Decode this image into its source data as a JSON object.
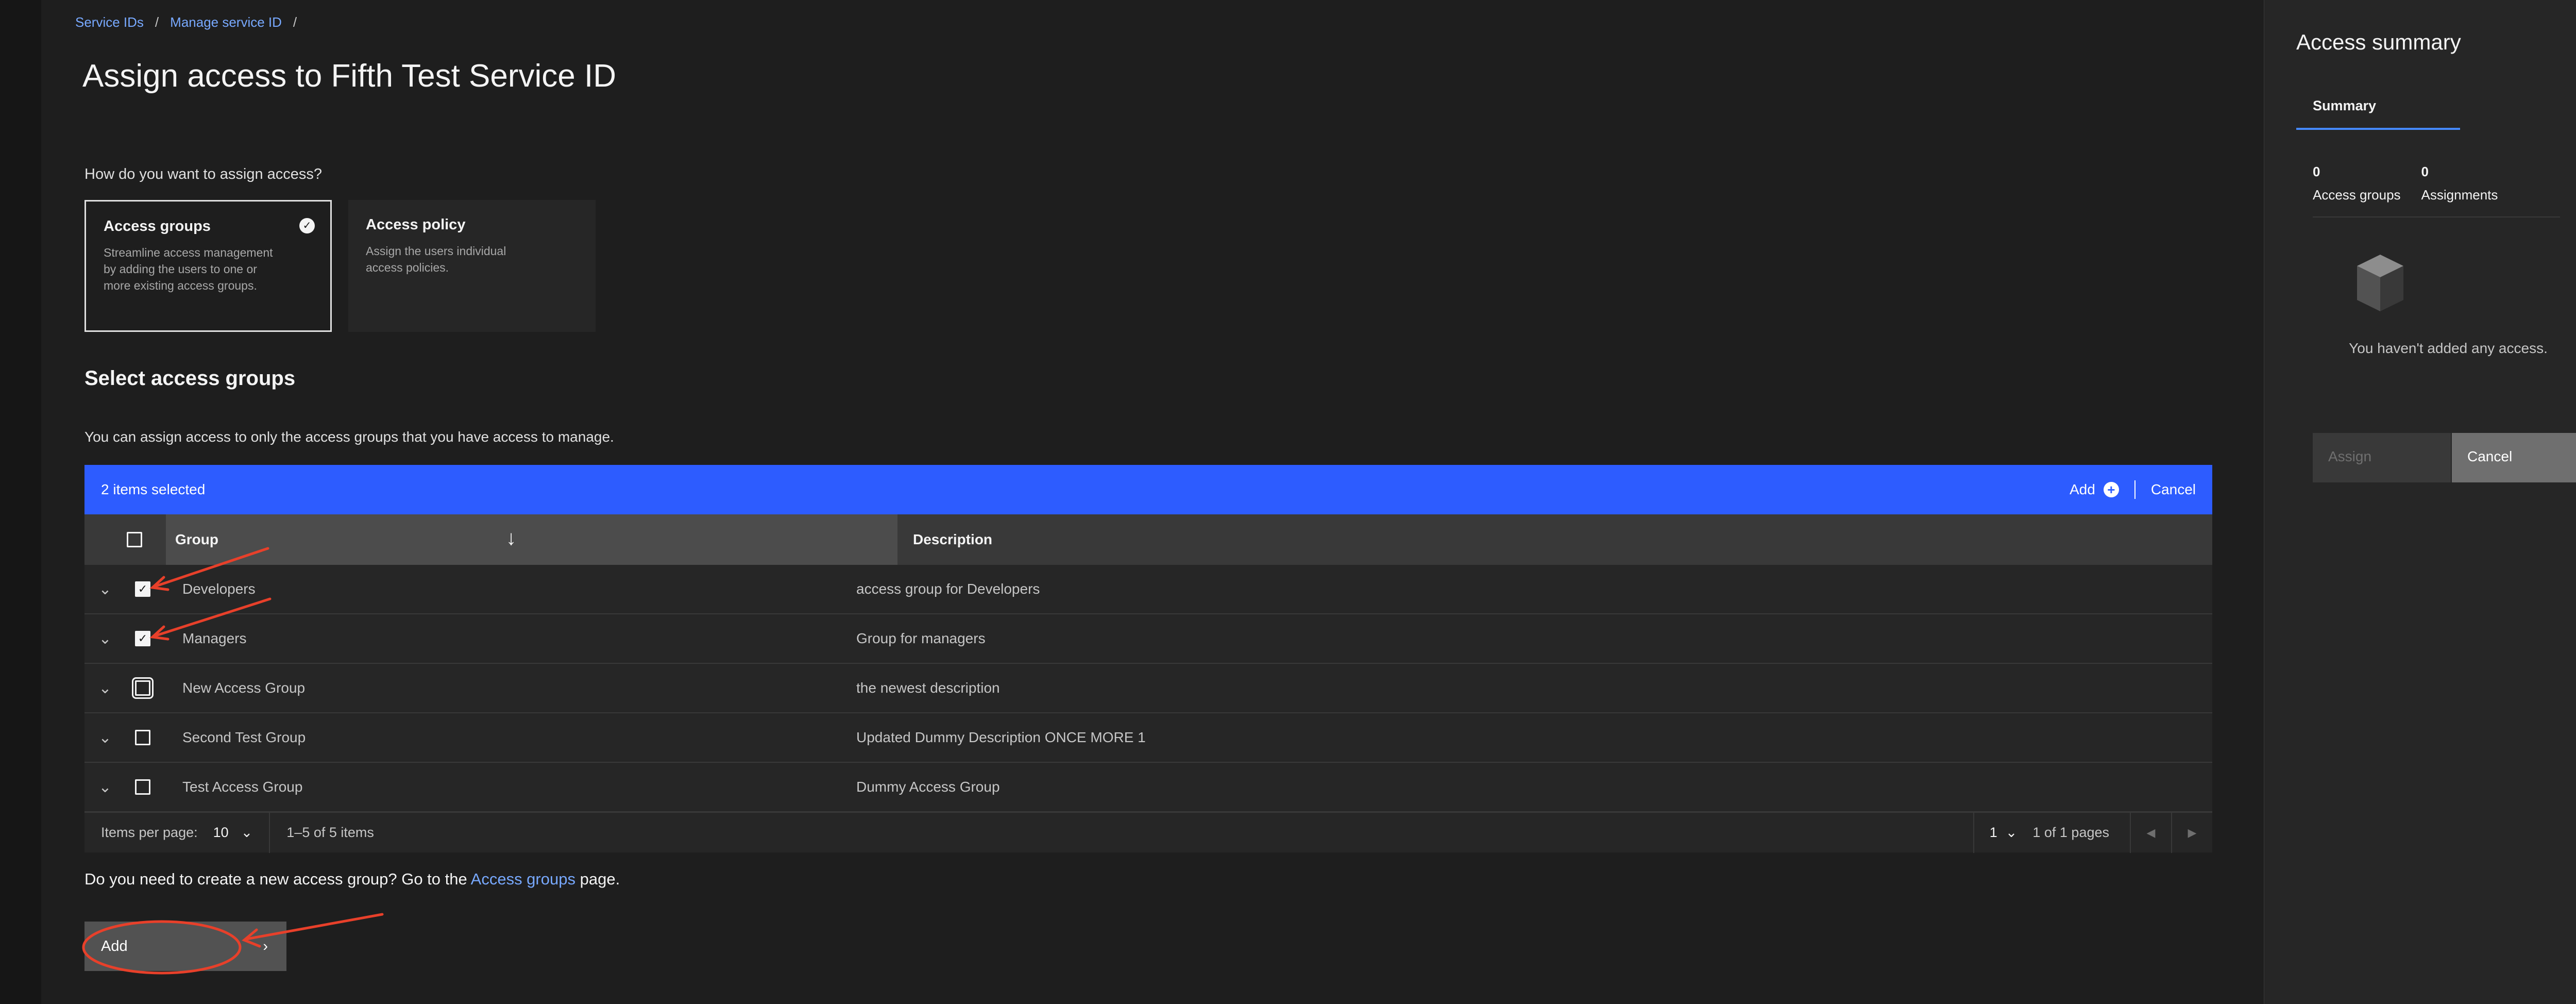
{
  "breadcrumb": {
    "item1": "Service IDs",
    "item2": "Manage service ID",
    "separator": "/"
  },
  "page_title": "Assign access to Fifth Test Service ID",
  "question": "How do you want to assign access?",
  "tiles": {
    "access_groups": {
      "title": "Access groups",
      "description": "Streamline access management by adding the users to one or more existing access groups.",
      "selected": true
    },
    "access_policy": {
      "title": "Access policy",
      "description": "Assign the users individual access policies."
    }
  },
  "section": {
    "title": "Select access groups",
    "description": "You can assign access to only the access groups that you have access to manage."
  },
  "batch_bar": {
    "count": "2 items selected",
    "add_label": "Add",
    "cancel_label": "Cancel",
    "color": "#2d5cff"
  },
  "table": {
    "headers": {
      "group": "Group",
      "description": "Description"
    },
    "rows": [
      {
        "group": "Developers",
        "description": "access group for Developers",
        "checked": true
      },
      {
        "group": "Managers",
        "description": "Group for managers",
        "checked": true
      },
      {
        "group": "New Access Group",
        "description": "the newest description",
        "checked": false
      },
      {
        "group": "Second Test Group",
        "description": "Updated Dummy Description ONCE MORE 1",
        "checked": false
      },
      {
        "group": "Test Access Group",
        "description": "Dummy Access Group",
        "checked": false
      }
    ]
  },
  "pagination": {
    "items_per_page_label": "Items per page:",
    "items_per_page_value": "10",
    "range": "1–5 of 5 items",
    "page_value": "1",
    "page_of": "1 of 1 pages"
  },
  "help": {
    "prefix": "Do you need to create a new access group? Go to the",
    "link": "Access groups",
    "suffix": "page."
  },
  "primary_button": {
    "label": "Add"
  },
  "summary": {
    "title": "Access summary",
    "tab": "Summary",
    "access_groups_count": "0",
    "access_groups_label": "Access groups",
    "assignments_count": "0",
    "assignments_label": "Assignments",
    "empty_message": "You haven't added any access.",
    "assign_label": "Assign",
    "cancel_label": "Cancel"
  },
  "icons": {
    "tile_check": "checkmark-filled-icon",
    "sort": "arrow-down-icon",
    "expand": "chevron-down-icon",
    "checkbox_check": "checkmark-icon",
    "add_circle": "add-filled-icon",
    "next": "chevron-right-icon",
    "empty_state": "cube-icon",
    "prev_page": "caret-left-icon",
    "next_page": "caret-right-icon"
  },
  "annotation_color": "#e8402a"
}
